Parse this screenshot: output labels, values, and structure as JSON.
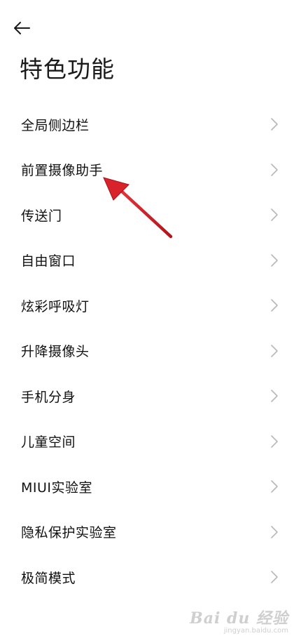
{
  "header": {
    "title": "特色功能",
    "back_icon": "arrow-left-icon"
  },
  "menu": {
    "items": [
      {
        "label": "全局侧边栏"
      },
      {
        "label": "前置摄像助手"
      },
      {
        "label": "传送门"
      },
      {
        "label": "自由窗口"
      },
      {
        "label": "炫彩呼吸灯"
      },
      {
        "label": "升降摄像头"
      },
      {
        "label": "手机分身"
      },
      {
        "label": "儿童空间"
      },
      {
        "label": "MIUI实验室"
      },
      {
        "label": "隐私保护实验室"
      },
      {
        "label": "极简模式"
      }
    ],
    "chevron_icon": "chevron-right-icon",
    "chevron_color": "#b8b8b8"
  },
  "annotation": {
    "arrow_color": "#d9232a",
    "points_to": "前置摄像助手"
  },
  "watermark": {
    "main": "Bai du 经验",
    "sub": "jingyan.baidu.com"
  }
}
